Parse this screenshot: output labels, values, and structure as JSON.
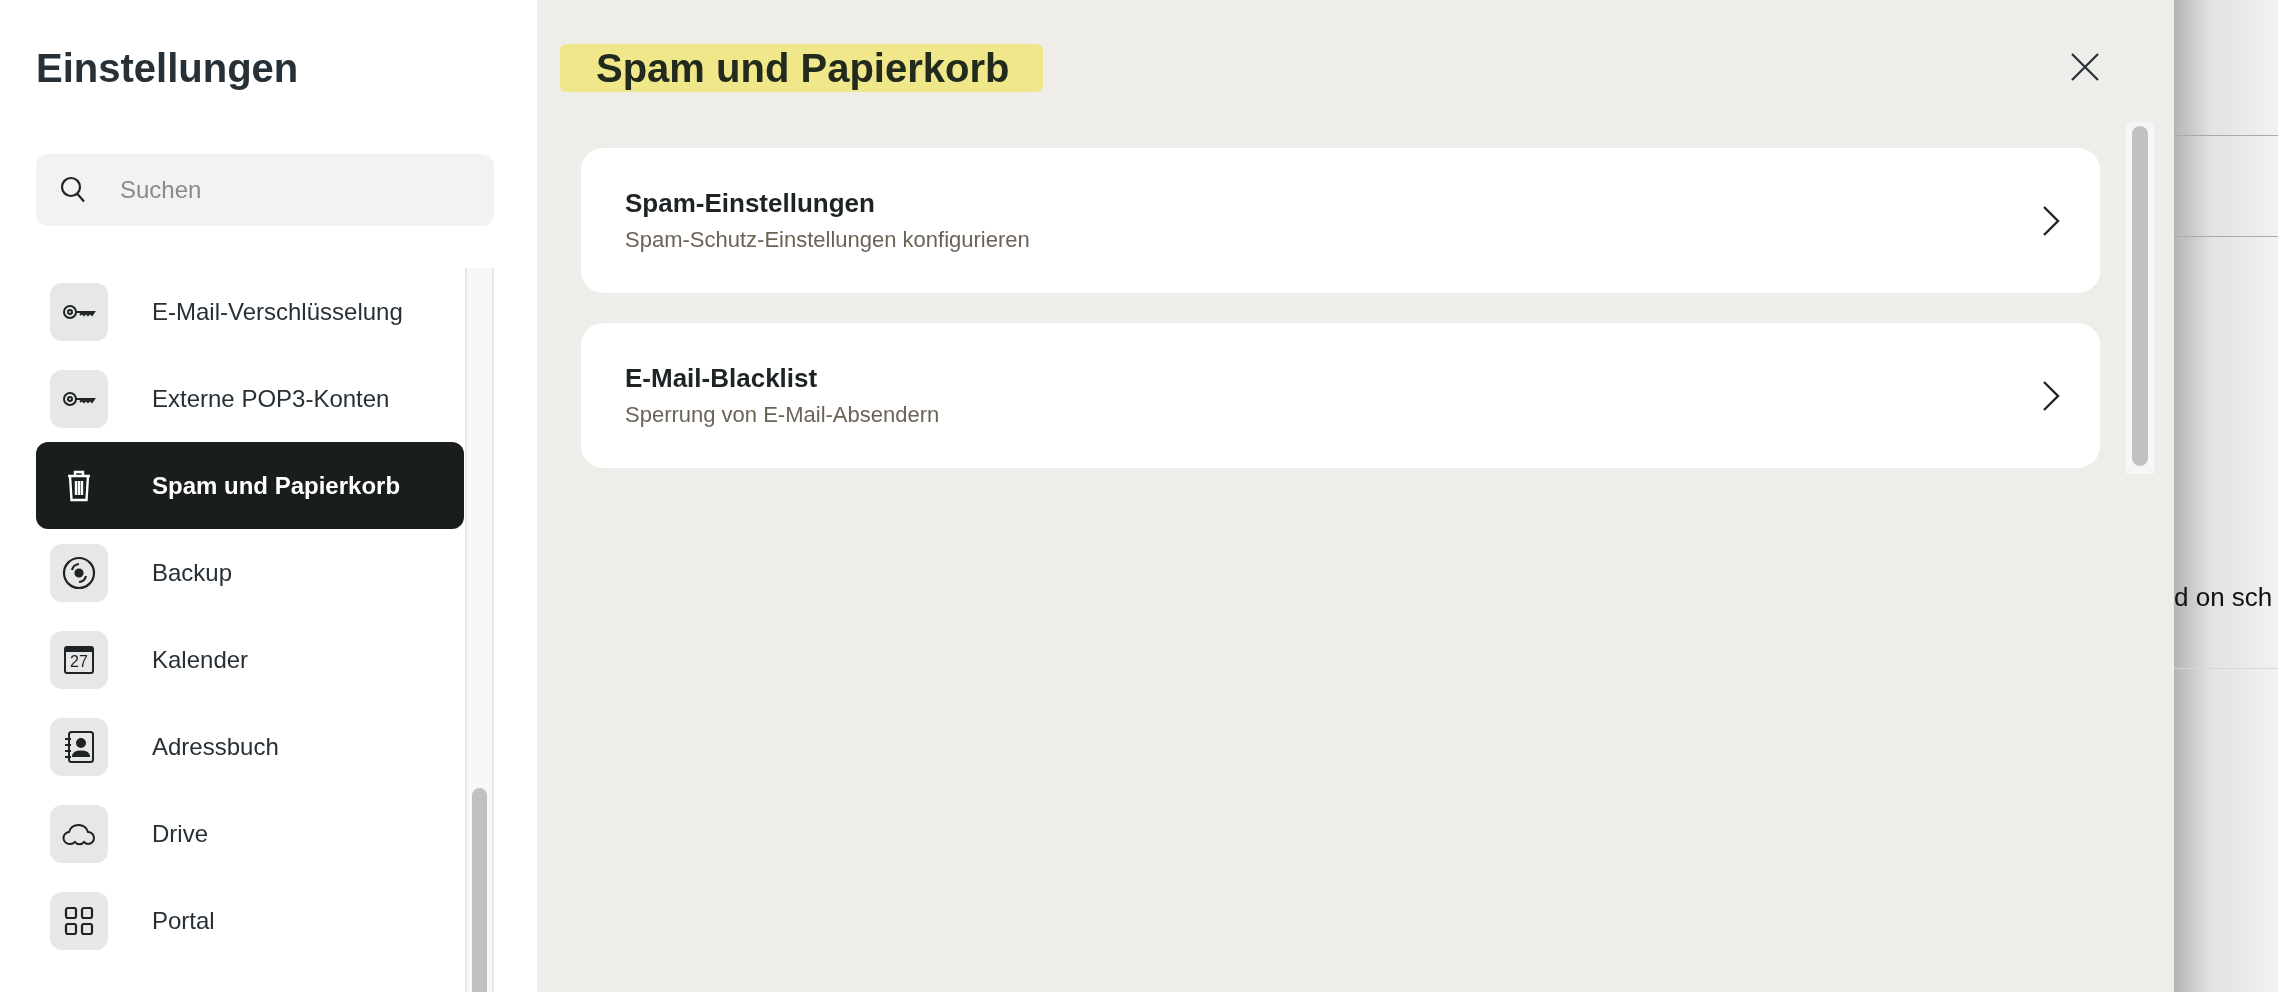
{
  "sidebar": {
    "title": "Einstellungen",
    "search": {
      "placeholder": "Suchen"
    },
    "items": [
      {
        "label": "E-Mail-Verschlüsselung",
        "kind": "key",
        "selected": false
      },
      {
        "label": "Externe POP3-Konten",
        "kind": "key",
        "selected": false
      },
      {
        "label": "Spam und Papierkorb",
        "kind": "trash",
        "selected": true
      },
      {
        "label": "Backup",
        "kind": "disc",
        "selected": false
      },
      {
        "label": "Kalender",
        "kind": "calendar",
        "calendar_day": "27",
        "selected": false
      },
      {
        "label": "Adressbuch",
        "kind": "contacts",
        "selected": false
      },
      {
        "label": "Drive",
        "kind": "cloud",
        "selected": false
      },
      {
        "label": "Portal",
        "kind": "grid",
        "selected": false
      }
    ]
  },
  "main": {
    "title": "Spam und Papierkorb",
    "cards": [
      {
        "title": "Spam-Einstellungen",
        "subtitle": "Spam-Schutz-Einstellungen konfigurieren"
      },
      {
        "title": "E-Mail-Blacklist",
        "subtitle": "Sperrung von E-Mail-Absendern"
      }
    ]
  },
  "background": {
    "text": "d on sch"
  }
}
